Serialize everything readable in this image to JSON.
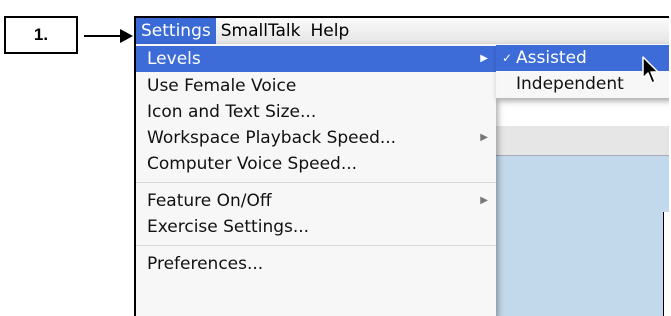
{
  "callout": {
    "step_label": "1."
  },
  "menubar": {
    "items": [
      {
        "label": "Settings"
      },
      {
        "label": "SmallTalk"
      },
      {
        "label": "Help"
      }
    ]
  },
  "settings_menu": {
    "items": [
      {
        "label": "Levels",
        "has_submenu": true,
        "selected": true
      },
      {
        "label": "Use Female Voice"
      },
      {
        "label": "Icon and Text Size..."
      },
      {
        "label": "Workspace Playback Speed...",
        "has_submenu": true
      },
      {
        "label": "Computer Voice Speed..."
      },
      {
        "label": "Feature On/Off",
        "has_submenu": true
      },
      {
        "label": "Exercise Settings..."
      },
      {
        "label": "Preferences..."
      }
    ]
  },
  "levels_submenu": {
    "items": [
      {
        "label": "Assisted",
        "checked": true,
        "selected": true
      },
      {
        "label": "Independent"
      }
    ]
  },
  "colors": {
    "highlight": "#3d6cd9",
    "menubar_active": "#3a6ad6"
  }
}
